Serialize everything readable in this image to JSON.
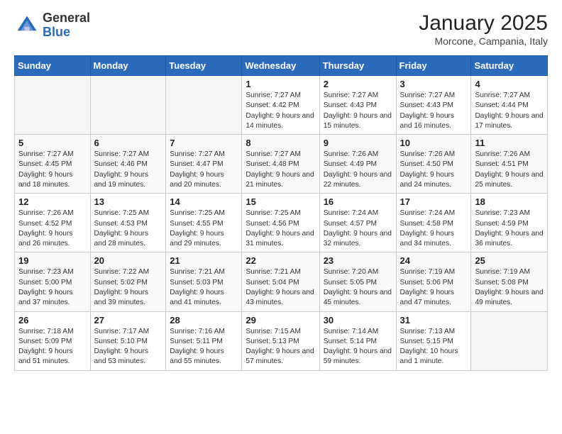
{
  "header": {
    "logo_general": "General",
    "logo_blue": "Blue",
    "month_title": "January 2025",
    "location": "Morcone, Campania, Italy"
  },
  "weekdays": [
    "Sunday",
    "Monday",
    "Tuesday",
    "Wednesday",
    "Thursday",
    "Friday",
    "Saturday"
  ],
  "weeks": [
    [
      {
        "day": "",
        "sunrise": "",
        "sunset": "",
        "daylight": ""
      },
      {
        "day": "",
        "sunrise": "",
        "sunset": "",
        "daylight": ""
      },
      {
        "day": "",
        "sunrise": "",
        "sunset": "",
        "daylight": ""
      },
      {
        "day": "1",
        "sunrise": "Sunrise: 7:27 AM",
        "sunset": "Sunset: 4:42 PM",
        "daylight": "Daylight: 9 hours and 14 minutes."
      },
      {
        "day": "2",
        "sunrise": "Sunrise: 7:27 AM",
        "sunset": "Sunset: 4:43 PM",
        "daylight": "Daylight: 9 hours and 15 minutes."
      },
      {
        "day": "3",
        "sunrise": "Sunrise: 7:27 AM",
        "sunset": "Sunset: 4:43 PM",
        "daylight": "Daylight: 9 hours and 16 minutes."
      },
      {
        "day": "4",
        "sunrise": "Sunrise: 7:27 AM",
        "sunset": "Sunset: 4:44 PM",
        "daylight": "Daylight: 9 hours and 17 minutes."
      }
    ],
    [
      {
        "day": "5",
        "sunrise": "Sunrise: 7:27 AM",
        "sunset": "Sunset: 4:45 PM",
        "daylight": "Daylight: 9 hours and 18 minutes."
      },
      {
        "day": "6",
        "sunrise": "Sunrise: 7:27 AM",
        "sunset": "Sunset: 4:46 PM",
        "daylight": "Daylight: 9 hours and 19 minutes."
      },
      {
        "day": "7",
        "sunrise": "Sunrise: 7:27 AM",
        "sunset": "Sunset: 4:47 PM",
        "daylight": "Daylight: 9 hours and 20 minutes."
      },
      {
        "day": "8",
        "sunrise": "Sunrise: 7:27 AM",
        "sunset": "Sunset: 4:48 PM",
        "daylight": "Daylight: 9 hours and 21 minutes."
      },
      {
        "day": "9",
        "sunrise": "Sunrise: 7:26 AM",
        "sunset": "Sunset: 4:49 PM",
        "daylight": "Daylight: 9 hours and 22 minutes."
      },
      {
        "day": "10",
        "sunrise": "Sunrise: 7:26 AM",
        "sunset": "Sunset: 4:50 PM",
        "daylight": "Daylight: 9 hours and 24 minutes."
      },
      {
        "day": "11",
        "sunrise": "Sunrise: 7:26 AM",
        "sunset": "Sunset: 4:51 PM",
        "daylight": "Daylight: 9 hours and 25 minutes."
      }
    ],
    [
      {
        "day": "12",
        "sunrise": "Sunrise: 7:26 AM",
        "sunset": "Sunset: 4:52 PM",
        "daylight": "Daylight: 9 hours and 26 minutes."
      },
      {
        "day": "13",
        "sunrise": "Sunrise: 7:25 AM",
        "sunset": "Sunset: 4:53 PM",
        "daylight": "Daylight: 9 hours and 28 minutes."
      },
      {
        "day": "14",
        "sunrise": "Sunrise: 7:25 AM",
        "sunset": "Sunset: 4:55 PM",
        "daylight": "Daylight: 9 hours and 29 minutes."
      },
      {
        "day": "15",
        "sunrise": "Sunrise: 7:25 AM",
        "sunset": "Sunset: 4:56 PM",
        "daylight": "Daylight: 9 hours and 31 minutes."
      },
      {
        "day": "16",
        "sunrise": "Sunrise: 7:24 AM",
        "sunset": "Sunset: 4:57 PM",
        "daylight": "Daylight: 9 hours and 32 minutes."
      },
      {
        "day": "17",
        "sunrise": "Sunrise: 7:24 AM",
        "sunset": "Sunset: 4:58 PM",
        "daylight": "Daylight: 9 hours and 34 minutes."
      },
      {
        "day": "18",
        "sunrise": "Sunrise: 7:23 AM",
        "sunset": "Sunset: 4:59 PM",
        "daylight": "Daylight: 9 hours and 36 minutes."
      }
    ],
    [
      {
        "day": "19",
        "sunrise": "Sunrise: 7:23 AM",
        "sunset": "Sunset: 5:00 PM",
        "daylight": "Daylight: 9 hours and 37 minutes."
      },
      {
        "day": "20",
        "sunrise": "Sunrise: 7:22 AM",
        "sunset": "Sunset: 5:02 PM",
        "daylight": "Daylight: 9 hours and 39 minutes."
      },
      {
        "day": "21",
        "sunrise": "Sunrise: 7:21 AM",
        "sunset": "Sunset: 5:03 PM",
        "daylight": "Daylight: 9 hours and 41 minutes."
      },
      {
        "day": "22",
        "sunrise": "Sunrise: 7:21 AM",
        "sunset": "Sunset: 5:04 PM",
        "daylight": "Daylight: 9 hours and 43 minutes."
      },
      {
        "day": "23",
        "sunrise": "Sunrise: 7:20 AM",
        "sunset": "Sunset: 5:05 PM",
        "daylight": "Daylight: 9 hours and 45 minutes."
      },
      {
        "day": "24",
        "sunrise": "Sunrise: 7:19 AM",
        "sunset": "Sunset: 5:06 PM",
        "daylight": "Daylight: 9 hours and 47 minutes."
      },
      {
        "day": "25",
        "sunrise": "Sunrise: 7:19 AM",
        "sunset": "Sunset: 5:08 PM",
        "daylight": "Daylight: 9 hours and 49 minutes."
      }
    ],
    [
      {
        "day": "26",
        "sunrise": "Sunrise: 7:18 AM",
        "sunset": "Sunset: 5:09 PM",
        "daylight": "Daylight: 9 hours and 51 minutes."
      },
      {
        "day": "27",
        "sunrise": "Sunrise: 7:17 AM",
        "sunset": "Sunset: 5:10 PM",
        "daylight": "Daylight: 9 hours and 53 minutes."
      },
      {
        "day": "28",
        "sunrise": "Sunrise: 7:16 AM",
        "sunset": "Sunset: 5:11 PM",
        "daylight": "Daylight: 9 hours and 55 minutes."
      },
      {
        "day": "29",
        "sunrise": "Sunrise: 7:15 AM",
        "sunset": "Sunset: 5:13 PM",
        "daylight": "Daylight: 9 hours and 57 minutes."
      },
      {
        "day": "30",
        "sunrise": "Sunrise: 7:14 AM",
        "sunset": "Sunset: 5:14 PM",
        "daylight": "Daylight: 9 hours and 59 minutes."
      },
      {
        "day": "31",
        "sunrise": "Sunrise: 7:13 AM",
        "sunset": "Sunset: 5:15 PM",
        "daylight": "Daylight: 10 hours and 1 minute."
      },
      {
        "day": "",
        "sunrise": "",
        "sunset": "",
        "daylight": ""
      }
    ]
  ]
}
